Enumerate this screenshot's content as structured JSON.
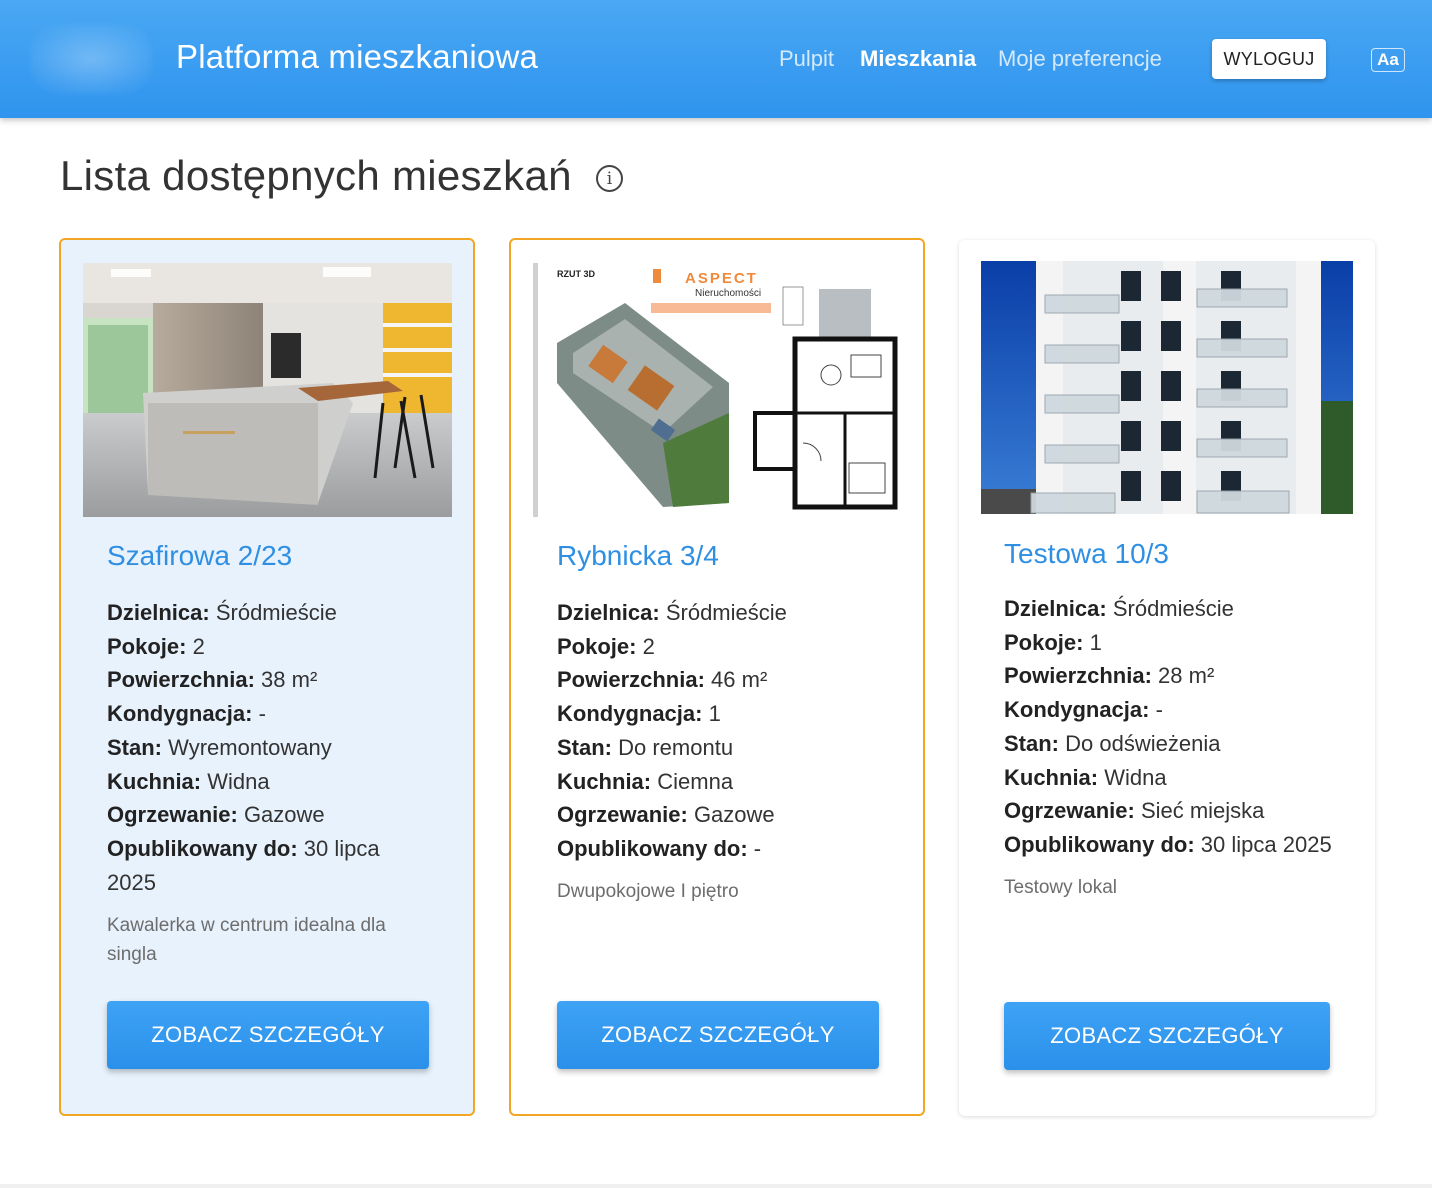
{
  "header": {
    "title": "Platforma mieszkaniowa",
    "nav": [
      {
        "label": "Pulpit",
        "active": false
      },
      {
        "label": "Mieszkania",
        "active": true
      },
      {
        "label": "Moje preferencje",
        "active": false
      }
    ],
    "logout_label": "WYLOGUJ",
    "font_toggle_label": "Aa"
  },
  "page": {
    "title": "Lista dostępnych mieszkań",
    "info_icon": "info-icon"
  },
  "listings": [
    {
      "title": "Szafirowa 2/23",
      "image": "kitchen-photo",
      "attributes": [
        {
          "label": "Dzielnica:",
          "value": "Śródmieście"
        },
        {
          "label": "Pokoje:",
          "value": "2"
        },
        {
          "label": "Powierzchnia:",
          "value": "38 m²"
        },
        {
          "label": "Kondygnacja:",
          "value": "-"
        },
        {
          "label": "Stan:",
          "value": "Wyremontowany"
        },
        {
          "label": "Kuchnia:",
          "value": "Widna"
        },
        {
          "label": "Ogrzewanie:",
          "value": "Gazowe"
        },
        {
          "label": "Opublikowany do:",
          "value": "30 lipca 2025"
        }
      ],
      "description": "Kawalerka w centrum idealna dla singla",
      "button_label": "ZOBACZ SZCZEGÓŁY"
    },
    {
      "title": "Rybnicka 3/4",
      "image": "floor-plan",
      "image_text": {
        "plan_label": "RZUT 3D",
        "brand": "ASPECT",
        "brand_sub": "Nieruchomości"
      },
      "attributes": [
        {
          "label": "Dzielnica:",
          "value": "Śródmieście"
        },
        {
          "label": "Pokoje:",
          "value": "2"
        },
        {
          "label": "Powierzchnia:",
          "value": "46 m²"
        },
        {
          "label": "Kondygnacja:",
          "value": "1"
        },
        {
          "label": "Stan:",
          "value": "Do remontu"
        },
        {
          "label": "Kuchnia:",
          "value": "Ciemna"
        },
        {
          "label": "Ogrzewanie:",
          "value": "Gazowe"
        },
        {
          "label": "Opublikowany do:",
          "value": "-"
        }
      ],
      "description": "Dwupokojowe I piętro",
      "button_label": "ZOBACZ SZCZEGÓŁY"
    },
    {
      "title": "Testowa 10/3",
      "image": "building-photo",
      "attributes": [
        {
          "label": "Dzielnica:",
          "value": "Śródmieście"
        },
        {
          "label": "Pokoje:",
          "value": "1"
        },
        {
          "label": "Powierzchnia:",
          "value": "28 m²"
        },
        {
          "label": "Kondygnacja:",
          "value": "-"
        },
        {
          "label": "Stan:",
          "value": "Do odświeżenia"
        },
        {
          "label": "Kuchnia:",
          "value": "Widna"
        },
        {
          "label": "Ogrzewanie:",
          "value": "Sieć miejska"
        },
        {
          "label": "Opublikowany do:",
          "value": "30 lipca 2025"
        }
      ],
      "description": "Testowy lokal",
      "button_label": "ZOBACZ SZCZEGÓŁY"
    }
  ],
  "colors": {
    "appbar": "#3a9ef2",
    "accent": "#2f8fe3",
    "highlight_border": "#f3a624",
    "selected_bg": "#e8f2fd"
  }
}
